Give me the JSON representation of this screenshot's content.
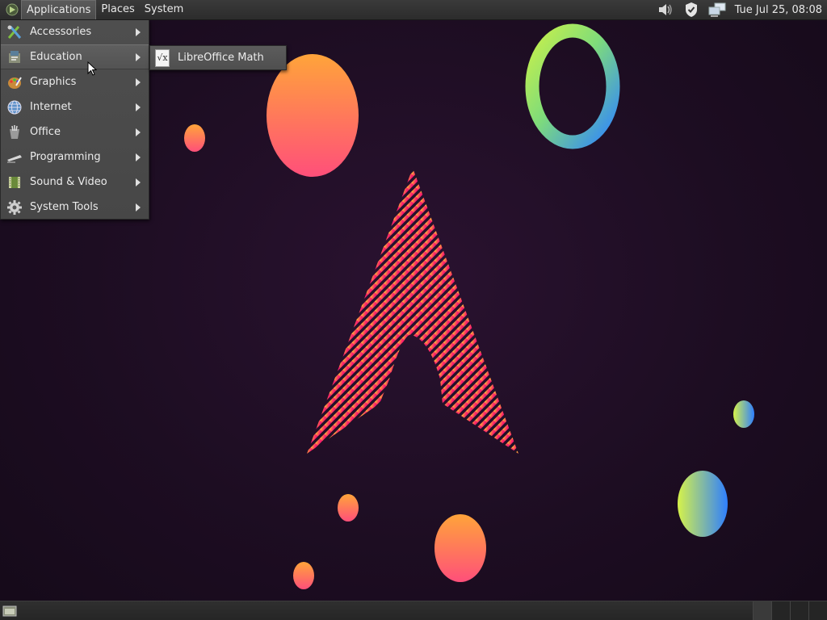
{
  "top_panel": {
    "menus": [
      "Applications",
      "Places",
      "System"
    ],
    "clock": "Tue Jul 25, 08:08",
    "tray_icons": [
      "volume-icon",
      "shield-icon",
      "network-icon"
    ]
  },
  "applications_menu": {
    "items": [
      {
        "label": "Accessories",
        "icon": "accessories-icon"
      },
      {
        "label": "Education",
        "icon": "education-icon"
      },
      {
        "label": "Graphics",
        "icon": "graphics-icon"
      },
      {
        "label": "Internet",
        "icon": "internet-icon"
      },
      {
        "label": "Office",
        "icon": "office-icon"
      },
      {
        "label": "Programming",
        "icon": "programming-icon"
      },
      {
        "label": "Sound & Video",
        "icon": "sound-video-icon"
      },
      {
        "label": "System Tools",
        "icon": "system-tools-icon"
      }
    ],
    "highlighted": "Education"
  },
  "education_submenu": {
    "items": [
      {
        "label": "LibreOffice Math",
        "icon": "libreoffice-math-icon",
        "icon_glyph": "√x"
      }
    ]
  },
  "colors": {
    "background": "#1d0d22",
    "panel": "#2c2c2c",
    "menu": "#4e4e4e",
    "wallpaper_pink": "#e91e63",
    "wallpaper_orange": "#ff9a3c"
  }
}
